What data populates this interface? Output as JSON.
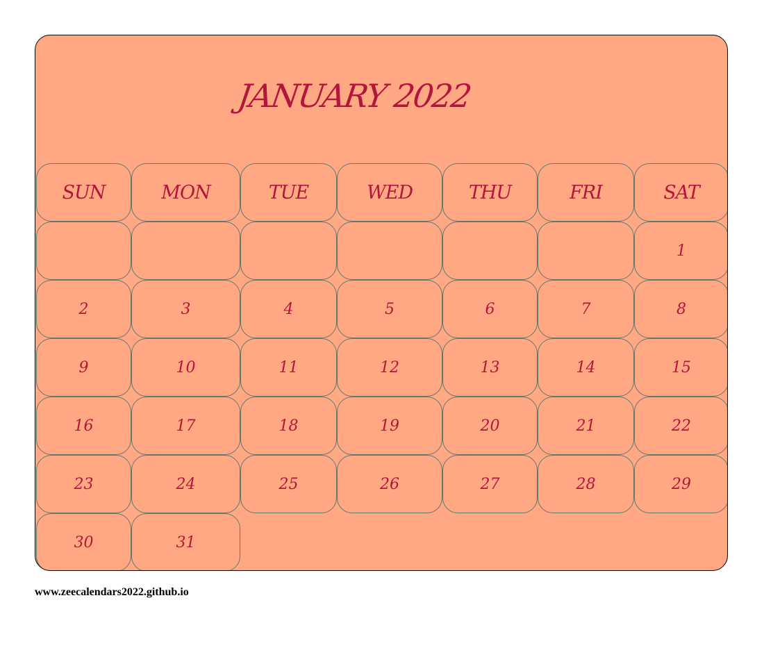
{
  "title": "JANUARY 2022",
  "weekdays": [
    "SUN",
    "MON",
    "TUE",
    "WED",
    "THU",
    "FRI",
    "SAT"
  ],
  "weeks": [
    [
      "",
      "",
      "",
      "",
      "",
      "",
      "1"
    ],
    [
      "2",
      "3",
      "4",
      "5",
      "6",
      "7",
      "8"
    ],
    [
      "9",
      "10",
      "11",
      "12",
      "13",
      "14",
      "15"
    ],
    [
      "16",
      "17",
      "18",
      "19",
      "20",
      "21",
      "22"
    ],
    [
      "23",
      "24",
      "25",
      "26",
      "27",
      "28",
      "29"
    ],
    [
      "30",
      "31"
    ]
  ],
  "footer": "www.zeecalendars2022.github.io",
  "colors": {
    "background": "#ffa883",
    "text": "#b2163a",
    "cell_border": "#5e7a6e"
  }
}
